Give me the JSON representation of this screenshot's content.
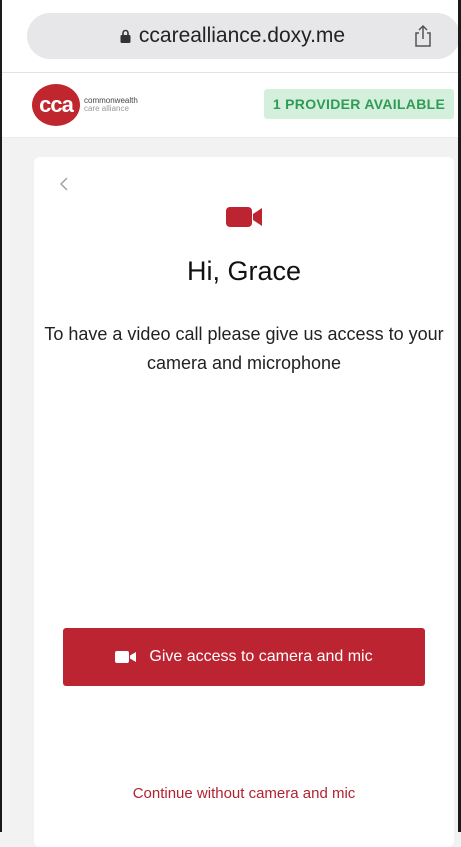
{
  "browser": {
    "url": "ccarealliance.doxy.me"
  },
  "header": {
    "logo_mark": "cca",
    "logo_line1": "commonwealth",
    "logo_line2": "care alliance",
    "provider_status": "1 PROVIDER AVAILABLE"
  },
  "main": {
    "greeting": "Hi, Grace",
    "message": "To have a video call please give us access to your camera and microphone",
    "primary_button_label": "Give access to camera and mic",
    "secondary_link_label": "Continue without camera and mic"
  },
  "colors": {
    "brand": "#bd2431",
    "status_green_bg": "#d4f0dd",
    "status_green_text": "#2f9b55"
  },
  "icons": {
    "lock": "lock-icon",
    "share": "share-icon",
    "back": "chevron-left-icon",
    "video": "video-camera-icon"
  }
}
